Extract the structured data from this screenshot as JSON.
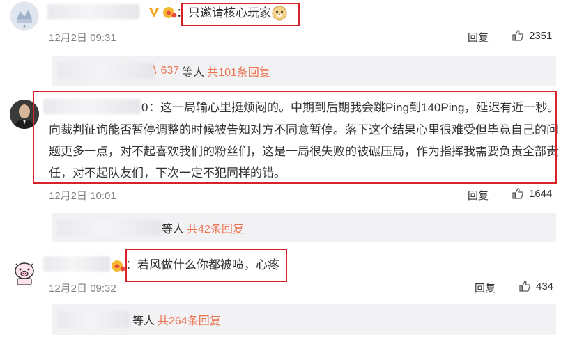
{
  "colors": {
    "accent": "#eb7350",
    "highlight_box": "#d9212a",
    "panel_bg": "#f2f2f5"
  },
  "comments": [
    {
      "text": "：只邀请核心玩家",
      "time": "12月2日 09:31",
      "reply_label": "回复",
      "likes": "2351",
      "sub": {
        "name_tail": "\\",
        "count": "637",
        "people": "等人",
        "total": "共101条回复"
      }
    },
    {
      "name_tail": "0",
      "lines": [
        "：这一局输心里挺烦闷的。中期到后期我会跳Ping到140Ping，延迟有近一秒。",
        "向裁判征询能否暂停调整的时候被告知对方不同意暂停。落下这个结果心里很难受但毕竟自己的问",
        "题更多一点，对不起喜欢我们的粉丝们，这是一局很失败的被碾压局，作为指挥我需要负责全部责",
        "任，对不起队友们，下次一定不犯同样的错。"
      ],
      "time": "12月2日 10:01",
      "reply_label": "回复",
      "likes": "1644",
      "sub": {
        "people": "等人",
        "total": "共42条回复"
      }
    },
    {
      "text": "：若风做什么你都被喷，心疼",
      "time": "12月2日 09:32",
      "reply_label": "回复",
      "likes": "434",
      "sub": {
        "people": "等人",
        "total": "共264条回复"
      }
    }
  ]
}
